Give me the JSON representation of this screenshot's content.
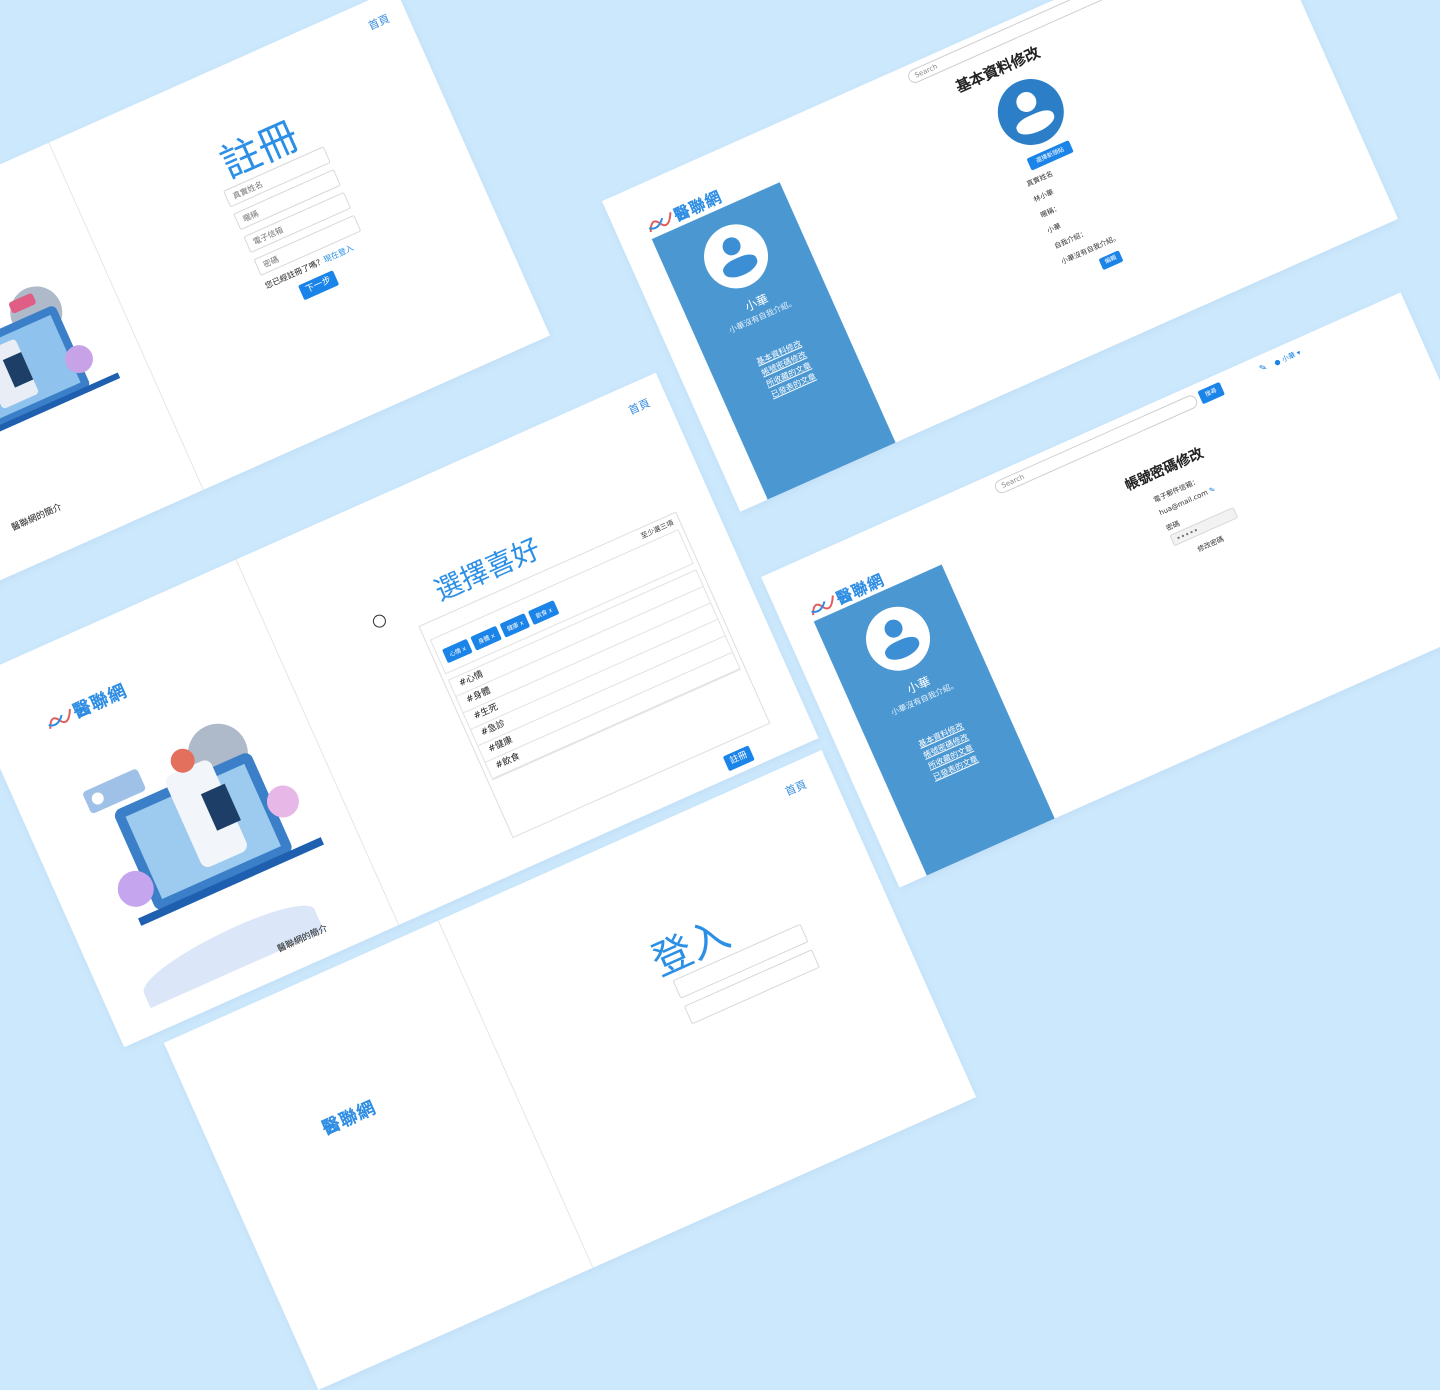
{
  "register": {
    "home": "首頁",
    "title": "註冊",
    "fields": [
      "真實姓名",
      "暱稱",
      "電子信箱",
      "密碼"
    ],
    "already": "您已經註冊了嗎？",
    "login_link": "現在登入",
    "next": "下一步",
    "intro": "醫聯網的簡介"
  },
  "preferences": {
    "home": "首頁",
    "title": "選擇喜好",
    "hint": "至少選三項",
    "selected": [
      "心情 x",
      "身體 x",
      "健康 x",
      "飲食 x"
    ],
    "options": [
      "#心情",
      "#身體",
      "#生死",
      "#急診",
      "#健康",
      "#飲食"
    ],
    "submit": "註冊",
    "logo": "醫聯網",
    "intro": "醫聯網的簡介"
  },
  "login": {
    "home": "首頁",
    "title": "登入",
    "logo": "醫聯網"
  },
  "profile": {
    "search": "Search",
    "title": "基本資料修改",
    "logo": "醫聯網",
    "name": "小華",
    "intro": "小華沒有自我介紹。",
    "links": [
      "基本資料修改",
      "帳號密碼修改",
      "所收藏的文章",
      "已發表的文章"
    ],
    "choose_avatar": "選擇新頭貼",
    "labels": [
      "真實姓名",
      "林小華",
      "暱稱：",
      "小華",
      "自我介紹：",
      "小華沒有自我介紹。"
    ],
    "edit": "編輯"
  },
  "account": {
    "search": "Search",
    "search_btn": "搜尋",
    "user_menu": "小華",
    "title": "帳號密碼修改",
    "logo": "醫聯網",
    "name": "小華",
    "intro": "小華沒有自我介紹。",
    "links": [
      "基本資料修改",
      "帳號密碼修改",
      "所收藏的文章",
      "已發表的文章"
    ],
    "email_label": "電子郵件信箱：",
    "email_value": "hua@mail.com",
    "password_label": "密碼",
    "password_value": "•••••",
    "change_password": "修改密碼"
  }
}
